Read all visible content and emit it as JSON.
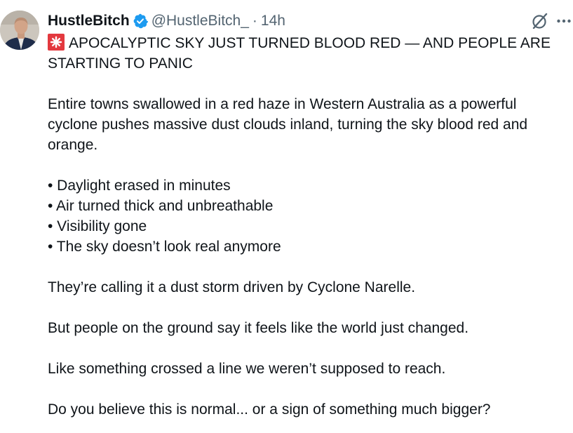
{
  "author": {
    "display_name": "HustleBitch",
    "handle": "@HustleBitch_",
    "separator": "·",
    "time": "14h",
    "verified": true,
    "verified_color": "#1d9bf0"
  },
  "icons": {
    "avatar": "profile-photo",
    "grok": "grok-icon",
    "more": "more-icon",
    "siren": "police-siren-emoji"
  },
  "post": {
    "headline": "APOCALYPTIC SKY JUST TURNED BLOOD RED — AND PEOPLE ARE STARTING TO PANIC",
    "intro": "Entire towns swallowed in a red haze in Western Australia as a powerful cyclone pushes massive dust clouds inland, turning the sky blood red and orange.",
    "bullets": [
      "• Daylight erased in minutes",
      "• Air turned thick and unbreathable",
      "• Visibility gone",
      "• The sky doesn’t look real anymore"
    ],
    "para1": "They’re calling it a dust storm driven by Cyclone Narelle.",
    "para2": "But people on the ground say it feels like the world just changed.",
    "para3": "Like something crossed a line we weren’t supposed to reach.",
    "para4": "Do you believe this is normal... or a sign of something much bigger?"
  }
}
